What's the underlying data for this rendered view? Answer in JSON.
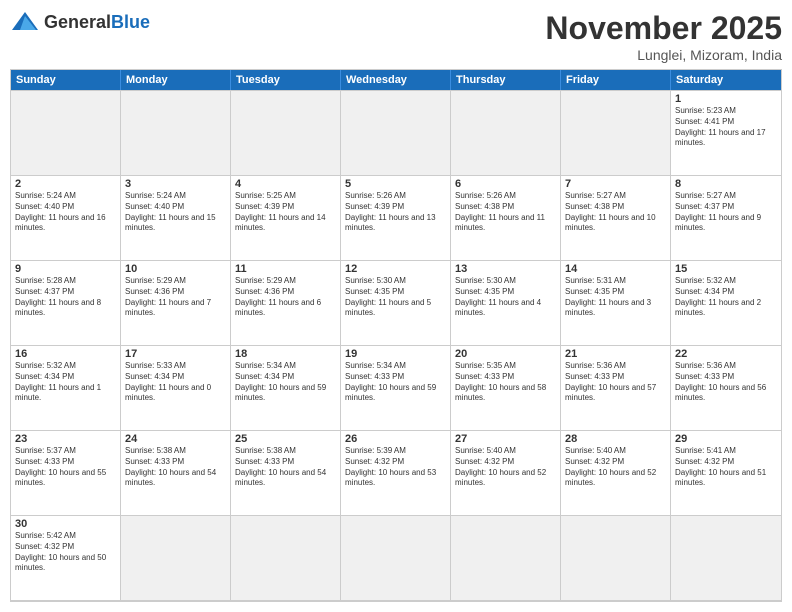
{
  "header": {
    "logo_general": "General",
    "logo_blue": "Blue",
    "month_title": "November 2025",
    "location": "Lunglei, Mizoram, India"
  },
  "day_headers": [
    "Sunday",
    "Monday",
    "Tuesday",
    "Wednesday",
    "Thursday",
    "Friday",
    "Saturday"
  ],
  "cells": [
    {
      "day": "",
      "empty": true,
      "info": ""
    },
    {
      "day": "",
      "empty": true,
      "info": ""
    },
    {
      "day": "",
      "empty": true,
      "info": ""
    },
    {
      "day": "",
      "empty": true,
      "info": ""
    },
    {
      "day": "",
      "empty": true,
      "info": ""
    },
    {
      "day": "",
      "empty": true,
      "info": ""
    },
    {
      "day": "1",
      "empty": false,
      "info": "Sunrise: 5:23 AM\nSunset: 4:41 PM\nDaylight: 11 hours and 17 minutes."
    },
    {
      "day": "2",
      "empty": false,
      "info": "Sunrise: 5:24 AM\nSunset: 4:40 PM\nDaylight: 11 hours and 16 minutes."
    },
    {
      "day": "3",
      "empty": false,
      "info": "Sunrise: 5:24 AM\nSunset: 4:40 PM\nDaylight: 11 hours and 15 minutes."
    },
    {
      "day": "4",
      "empty": false,
      "info": "Sunrise: 5:25 AM\nSunset: 4:39 PM\nDaylight: 11 hours and 14 minutes."
    },
    {
      "day": "5",
      "empty": false,
      "info": "Sunrise: 5:26 AM\nSunset: 4:39 PM\nDaylight: 11 hours and 13 minutes."
    },
    {
      "day": "6",
      "empty": false,
      "info": "Sunrise: 5:26 AM\nSunset: 4:38 PM\nDaylight: 11 hours and 11 minutes."
    },
    {
      "day": "7",
      "empty": false,
      "info": "Sunrise: 5:27 AM\nSunset: 4:38 PM\nDaylight: 11 hours and 10 minutes."
    },
    {
      "day": "8",
      "empty": false,
      "info": "Sunrise: 5:27 AM\nSunset: 4:37 PM\nDaylight: 11 hours and 9 minutes."
    },
    {
      "day": "9",
      "empty": false,
      "info": "Sunrise: 5:28 AM\nSunset: 4:37 PM\nDaylight: 11 hours and 8 minutes."
    },
    {
      "day": "10",
      "empty": false,
      "info": "Sunrise: 5:29 AM\nSunset: 4:36 PM\nDaylight: 11 hours and 7 minutes."
    },
    {
      "day": "11",
      "empty": false,
      "info": "Sunrise: 5:29 AM\nSunset: 4:36 PM\nDaylight: 11 hours and 6 minutes."
    },
    {
      "day": "12",
      "empty": false,
      "info": "Sunrise: 5:30 AM\nSunset: 4:35 PM\nDaylight: 11 hours and 5 minutes."
    },
    {
      "day": "13",
      "empty": false,
      "info": "Sunrise: 5:30 AM\nSunset: 4:35 PM\nDaylight: 11 hours and 4 minutes."
    },
    {
      "day": "14",
      "empty": false,
      "info": "Sunrise: 5:31 AM\nSunset: 4:35 PM\nDaylight: 11 hours and 3 minutes."
    },
    {
      "day": "15",
      "empty": false,
      "info": "Sunrise: 5:32 AM\nSunset: 4:34 PM\nDaylight: 11 hours and 2 minutes."
    },
    {
      "day": "16",
      "empty": false,
      "info": "Sunrise: 5:32 AM\nSunset: 4:34 PM\nDaylight: 11 hours and 1 minute."
    },
    {
      "day": "17",
      "empty": false,
      "info": "Sunrise: 5:33 AM\nSunset: 4:34 PM\nDaylight: 11 hours and 0 minutes."
    },
    {
      "day": "18",
      "empty": false,
      "info": "Sunrise: 5:34 AM\nSunset: 4:34 PM\nDaylight: 10 hours and 59 minutes."
    },
    {
      "day": "19",
      "empty": false,
      "info": "Sunrise: 5:34 AM\nSunset: 4:33 PM\nDaylight: 10 hours and 59 minutes."
    },
    {
      "day": "20",
      "empty": false,
      "info": "Sunrise: 5:35 AM\nSunset: 4:33 PM\nDaylight: 10 hours and 58 minutes."
    },
    {
      "day": "21",
      "empty": false,
      "info": "Sunrise: 5:36 AM\nSunset: 4:33 PM\nDaylight: 10 hours and 57 minutes."
    },
    {
      "day": "22",
      "empty": false,
      "info": "Sunrise: 5:36 AM\nSunset: 4:33 PM\nDaylight: 10 hours and 56 minutes."
    },
    {
      "day": "23",
      "empty": false,
      "info": "Sunrise: 5:37 AM\nSunset: 4:33 PM\nDaylight: 10 hours and 55 minutes."
    },
    {
      "day": "24",
      "empty": false,
      "info": "Sunrise: 5:38 AM\nSunset: 4:33 PM\nDaylight: 10 hours and 54 minutes."
    },
    {
      "day": "25",
      "empty": false,
      "info": "Sunrise: 5:38 AM\nSunset: 4:33 PM\nDaylight: 10 hours and 54 minutes."
    },
    {
      "day": "26",
      "empty": false,
      "info": "Sunrise: 5:39 AM\nSunset: 4:32 PM\nDaylight: 10 hours and 53 minutes."
    },
    {
      "day": "27",
      "empty": false,
      "info": "Sunrise: 5:40 AM\nSunset: 4:32 PM\nDaylight: 10 hours and 52 minutes."
    },
    {
      "day": "28",
      "empty": false,
      "info": "Sunrise: 5:40 AM\nSunset: 4:32 PM\nDaylight: 10 hours and 52 minutes."
    },
    {
      "day": "29",
      "empty": false,
      "info": "Sunrise: 5:41 AM\nSunset: 4:32 PM\nDaylight: 10 hours and 51 minutes."
    },
    {
      "day": "30",
      "empty": false,
      "info": "Sunrise: 5:42 AM\nSunset: 4:32 PM\nDaylight: 10 hours and 50 minutes."
    },
    {
      "day": "",
      "empty": true,
      "info": ""
    },
    {
      "day": "",
      "empty": true,
      "info": ""
    },
    {
      "day": "",
      "empty": true,
      "info": ""
    },
    {
      "day": "",
      "empty": true,
      "info": ""
    },
    {
      "day": "",
      "empty": true,
      "info": ""
    },
    {
      "day": "",
      "empty": true,
      "info": ""
    }
  ]
}
